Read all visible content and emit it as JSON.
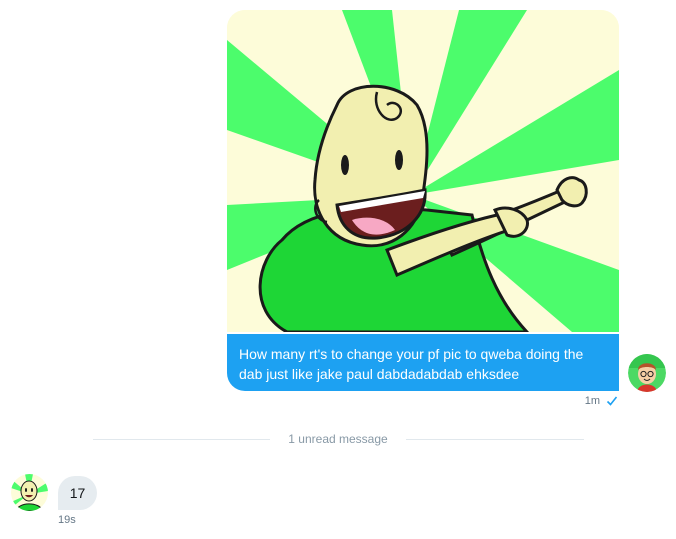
{
  "conversation": {
    "sent": {
      "image_alt": "cartoon character doing the dab",
      "text": "How many rt's to change your pf pic to qweba doing the dab just like jake paul dabdadabdab ehksdee",
      "time": "1m",
      "status_icon": "check-icon"
    },
    "divider_label": "1 unread message",
    "received": {
      "text": "17",
      "time": "19s"
    }
  },
  "colors": {
    "sent_bubble": "#1da1f2",
    "received_bubble": "#e6ecf0",
    "sunburst_green": "#4cfc6c",
    "sunburst_cream": "#fdfcd9"
  }
}
